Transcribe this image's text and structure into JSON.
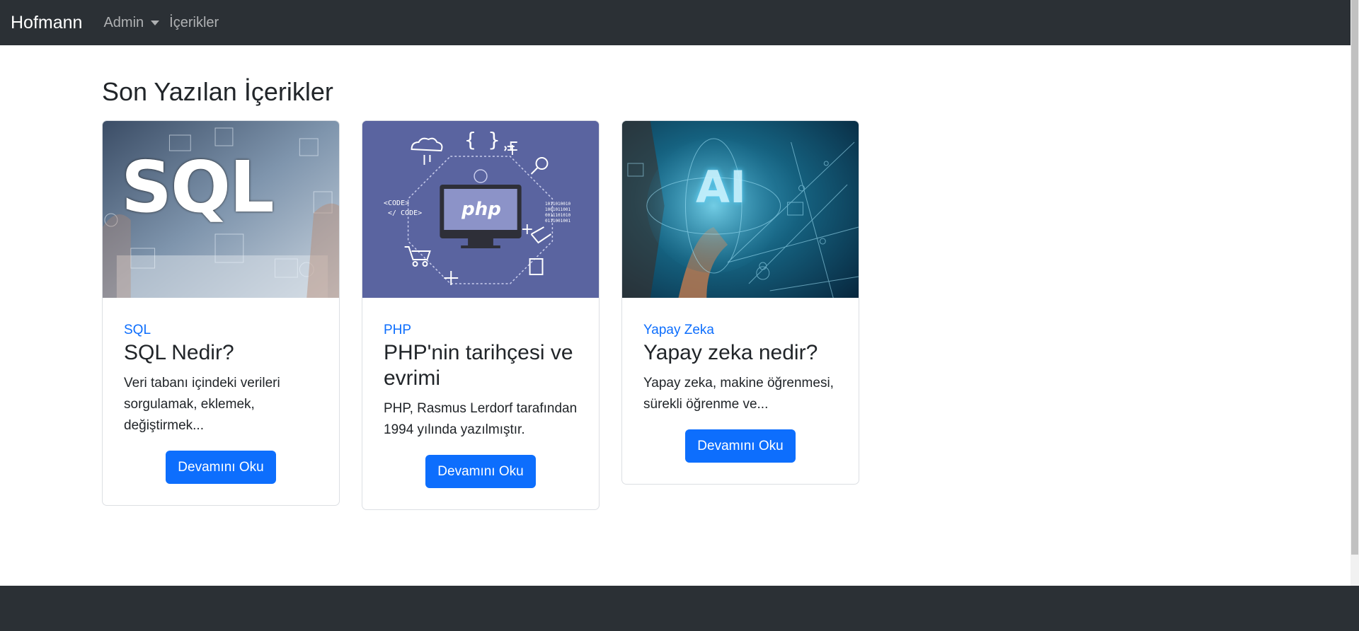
{
  "navbar": {
    "brand": "Hofmann",
    "items": [
      {
        "label": "Admin",
        "dropdown": true
      },
      {
        "label": "İçerikler",
        "dropdown": false
      }
    ]
  },
  "main": {
    "title": "Son Yazılan İçerikler",
    "cards": [
      {
        "image_text": "SQL",
        "category": "SQL",
        "title": "SQL Nedir?",
        "excerpt": "Veri tabanı içindeki verileri sorgulamak, eklemek, değiştirmek...",
        "button": "Devamını Oku"
      },
      {
        "image_text": "php",
        "image_labels": [
          "<CODE>",
          "</ CODE>",
          "1011010010",
          "1001011001",
          "0011101010",
          "0111001001"
        ],
        "category": "PHP",
        "title": "PHP'nin tarihçesi ve evrimi",
        "excerpt": "PHP, Rasmus Lerdorf tarafından 1994 yılında yazılmıştır.",
        "button": "Devamını Oku"
      },
      {
        "image_text": "AI",
        "category": "Yapay Zeka",
        "title": "Yapay zeka nedir?",
        "excerpt": "Yapay zeka, makine öğrenmesi, sürekli öğrenme ve...",
        "button": "Devamını Oku"
      }
    ]
  },
  "colors": {
    "navbar_bg": "#2b3035",
    "accent": "#0d6efd",
    "php_bg": "#5a64a0"
  }
}
